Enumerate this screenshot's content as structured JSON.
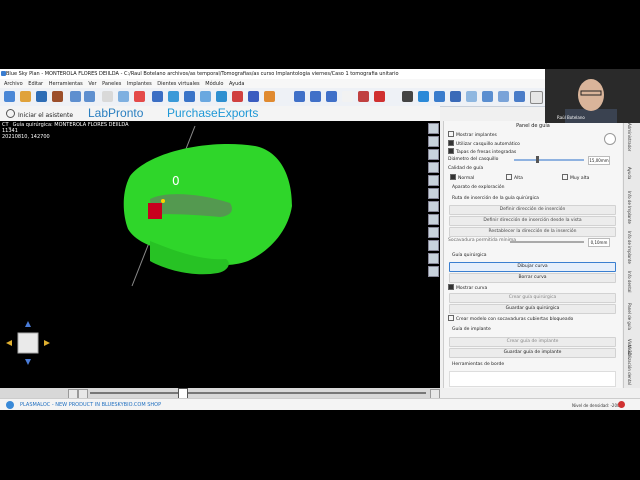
{
  "window": {
    "title": "Blue Sky Plan - MONTEROLA FLORES DEIILDA - C:/Raul Botelano archivos/as temporal/Tomografias/as curso Implantologia viernes/Caso 1 tomografia unitario"
  },
  "menu": [
    "Archivo",
    "Editar",
    "Herramientas",
    "Ver",
    "Paneles",
    "Implantes",
    "Dientes virtuales",
    "Módulo",
    "Ayuda"
  ],
  "wizard": {
    "label": "Iniciar el asistente"
  },
  "logos": {
    "labpronto": "LabPronto",
    "purchase": "PurchaseExports"
  },
  "viewport": {
    "info_line1": "CT_ Guía quirúrgica: MONTEROLA FLORES DEIILDA",
    "info_line2": "11341",
    "info_line3": "20210810, 142700",
    "marker": "0"
  },
  "panel": {
    "title": "Panel de guía",
    "mostrar_implantes": "Mostrar implantes",
    "utilizar_casquillo": "Utilizar casquillo automático",
    "tapas_fresas": "Tapas de fresas integradas",
    "diametro_label": "Diámetro del casquillo",
    "diametro_value": "15,00mm",
    "calidad_label": "Calidad de guía",
    "calidad_options": [
      "Normal",
      "Alta",
      "Muy alta"
    ],
    "aparato": "Aparato de exploración",
    "ruta_label": "Ruta de inserción de la guía quirúrgica",
    "btn_definir_dir": "Definir dirección de inserción",
    "btn_definir_vista": "Definir dirección de inserción desde la vista",
    "btn_restablecer": "Restablecer la dirección de la inserción",
    "socavadura": "Socavadura permitida mínima",
    "socavadura_value": "0,10mm",
    "guia_quirurgica": "Guía quirúrgica",
    "btn_dibujar": "Dibujar curva",
    "btn_borrar": "Borrar curva",
    "mostrar_curva": "Mostrar curva",
    "btn_crear_guia": "Crear guía quirúrgica",
    "btn_guardar_guia": "Guardar guía quirúrgica",
    "crear_modelo": "Crear modelo con socavaduras cubiertas bloqueado",
    "guia_implante": "Guía de implante",
    "btn_crear_implante": "Crear guía de implante",
    "btn_guardar_implante": "Guardar guía de implante",
    "herramientas": "Herramientas de borde"
  },
  "vtabs": [
    "Administrador",
    "Ayuda",
    "Info de Implante",
    "Info de implante",
    "Info dental",
    "Panel de guía",
    "Vista 3D",
    "Visualización dental"
  ],
  "status": {
    "news": "PLASMALOC - NEW PRODUCT IN BLUESKYBIO.COM SHOP",
    "density": "Nivel de densidad: -2000"
  },
  "webcam": {
    "name": "Raúl Botelano"
  },
  "colors": {
    "model": "#2fd62a",
    "selection": "#c8001e",
    "accent": "#1f6fc0"
  }
}
